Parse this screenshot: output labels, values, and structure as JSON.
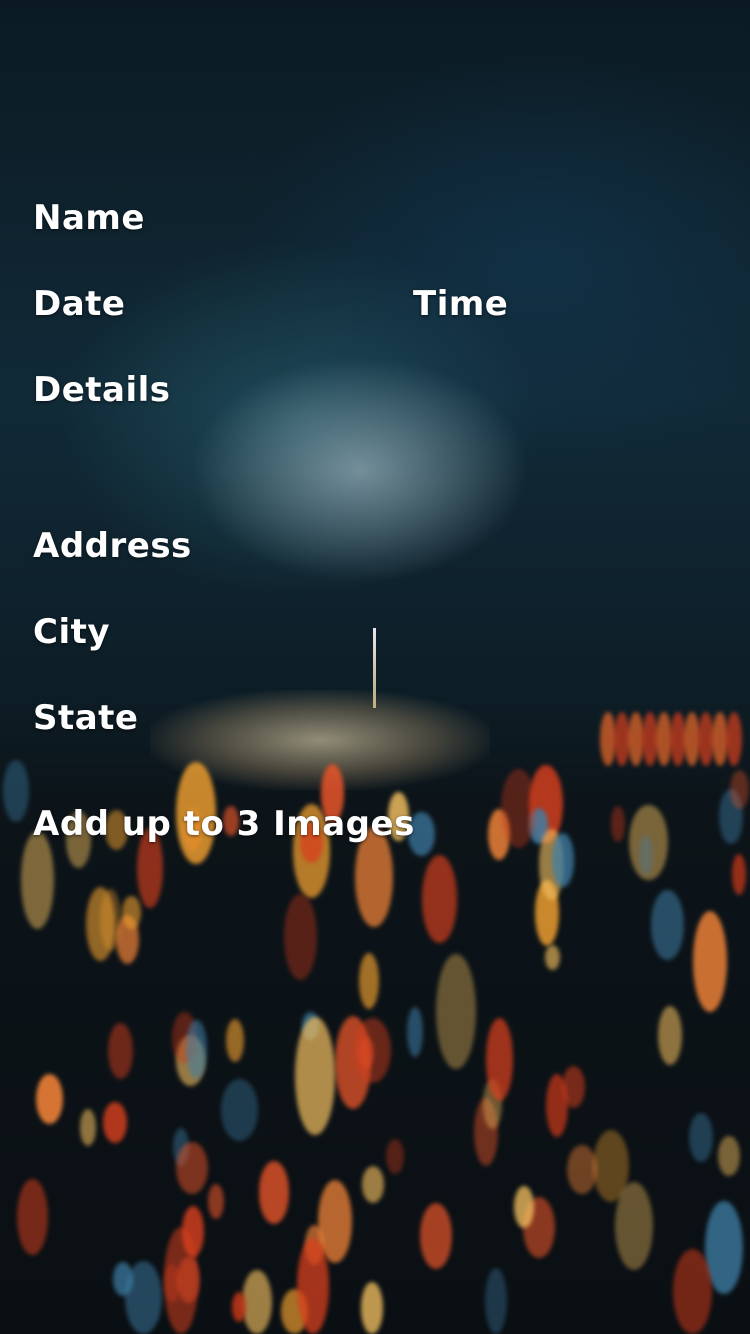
{
  "form": {
    "name_label": "Name",
    "date_label": "Date",
    "time_label": "Time",
    "details_label": "Details",
    "address_label": "Address",
    "city_label": "City",
    "state_label": "State",
    "images_label": "Add up to 3 Images"
  },
  "colors": {
    "text": "#ffffff",
    "bokeh_warm": "#e8552a",
    "bokeh_amber": "#f0a030",
    "sky_teal": "#1f4a5c"
  }
}
